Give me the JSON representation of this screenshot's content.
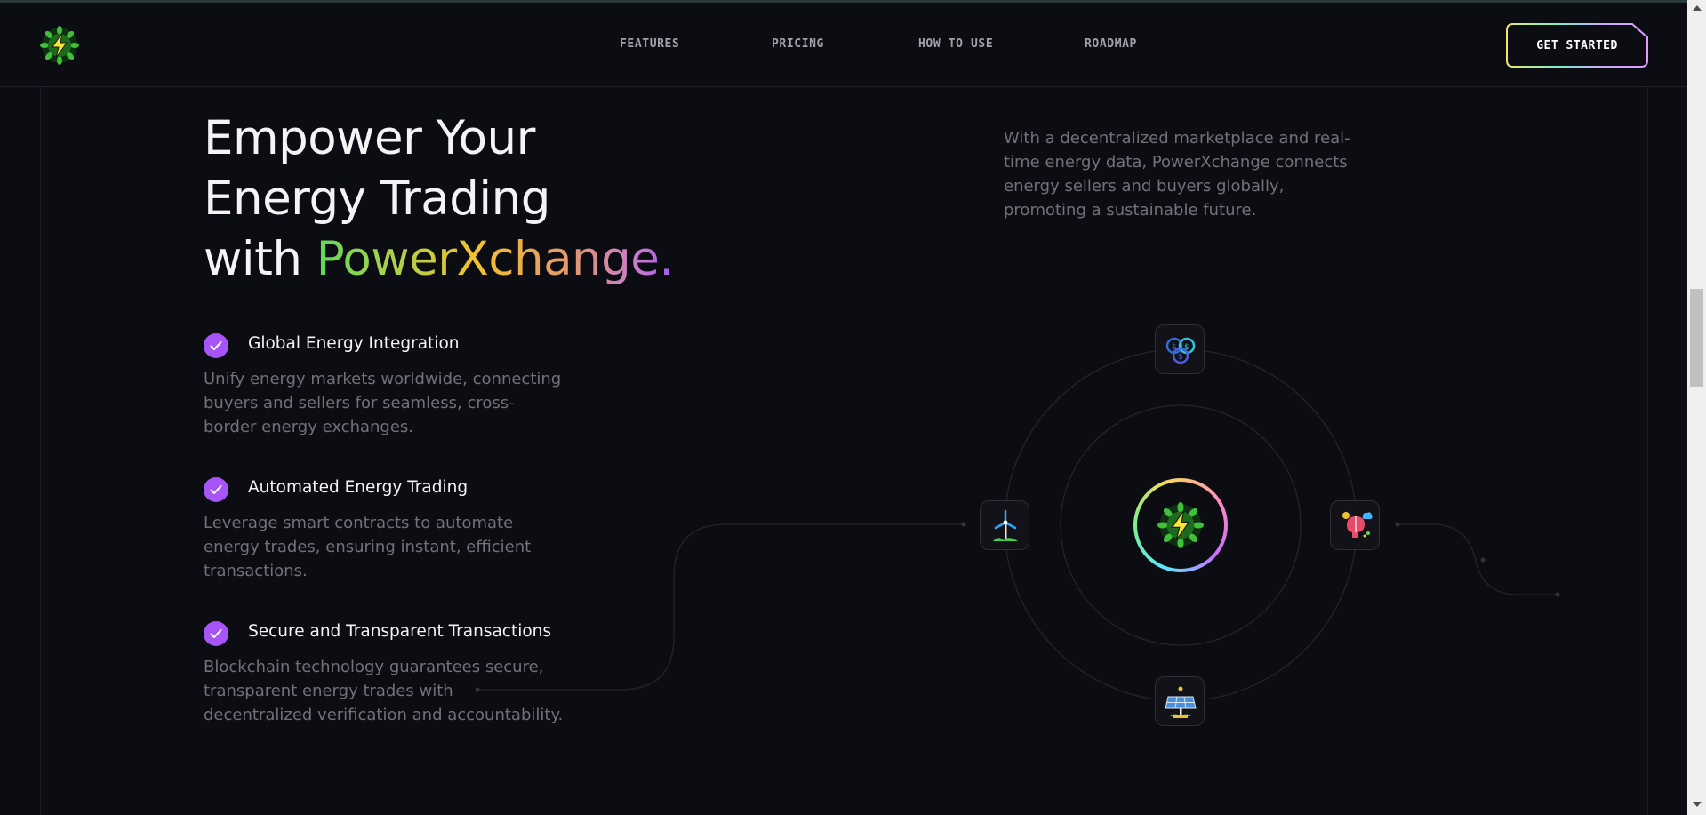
{
  "nav": {
    "links": [
      {
        "label": "FEATURES"
      },
      {
        "label": "PRICING"
      },
      {
        "label": "HOW TO USE"
      },
      {
        "label": "ROADMAP"
      }
    ],
    "cta_label": "GET STARTED"
  },
  "hero": {
    "title_line1": "Empower Your",
    "title_line2": "Energy Trading",
    "title_line3_prefix": "with ",
    "title_brand": "PowerXchange.",
    "lead": "With a decentralized marketplace and real-time energy data, PowerXchange connects energy sellers and buyers globally, promoting a sustainable future."
  },
  "features": [
    {
      "title": "Global Energy Integration",
      "description": "Unify energy markets worldwide, connecting buyers and sellers for seamless, cross-border energy exchanges."
    },
    {
      "title": "Automated Energy Trading",
      "description": "Leverage smart contracts to automate energy trades, ensuring instant, efficient transactions."
    },
    {
      "title": "Secure and Transparent Transactions",
      "description": "Blockchain technology guarantees secure, transparent energy trades with decentralized verification and accountability."
    }
  ],
  "diagram": {
    "nodes": [
      "coins-icon",
      "wind-turbine-icon",
      "brain-icon",
      "solar-panel-icon"
    ],
    "hub": "lightning-leaf-icon"
  },
  "colors": {
    "background": "#0c0c13",
    "accent": "#a855f7",
    "muted_text": "#71717a"
  }
}
